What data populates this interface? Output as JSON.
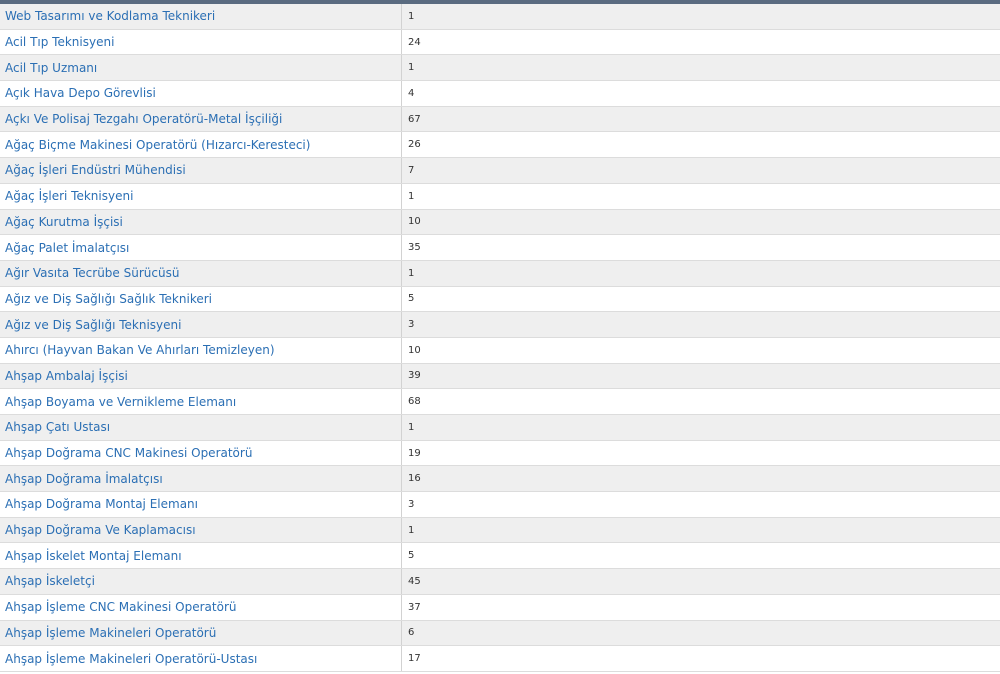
{
  "colors": {
    "link": "#2b6fb4",
    "header_bar": "#5a6b80",
    "row_alt": "#efefef"
  },
  "rows": [
    {
      "name": "Web Tasarımı ve Kodlama Teknikeri",
      "count": "1"
    },
    {
      "name": "Acil Tıp Teknisyeni",
      "count": "24"
    },
    {
      "name": "Acil Tıp Uzmanı",
      "count": "1"
    },
    {
      "name": "Açık Hava Depo Görevlisi",
      "count": "4"
    },
    {
      "name": "Açkı Ve Polisaj Tezgahı Operatörü-Metal İşçiliği",
      "count": "67"
    },
    {
      "name": "Ağaç Biçme Makinesi Operatörü (Hızarcı-Keresteci)",
      "count": "26"
    },
    {
      "name": "Ağaç İşleri Endüstri Mühendisi",
      "count": "7"
    },
    {
      "name": "Ağaç İşleri Teknisyeni",
      "count": "1"
    },
    {
      "name": "Ağaç Kurutma İşçisi",
      "count": "10"
    },
    {
      "name": "Ağaç Palet İmalatçısı",
      "count": "35"
    },
    {
      "name": "Ağır Vasıta Tecrübe Sürücüsü",
      "count": "1"
    },
    {
      "name": "Ağız ve Diş Sağlığı Sağlık Teknikeri",
      "count": "5"
    },
    {
      "name": "Ağız ve Diş Sağlığı Teknisyeni",
      "count": "3"
    },
    {
      "name": "Ahırcı (Hayvan Bakan Ve Ahırları Temizleyen)",
      "count": "10"
    },
    {
      "name": "Ahşap Ambalaj İşçisi",
      "count": "39"
    },
    {
      "name": "Ahşap Boyama ve Vernikleme Elemanı",
      "count": "68"
    },
    {
      "name": "Ahşap Çatı Ustası",
      "count": "1"
    },
    {
      "name": "Ahşap Doğrama CNC Makinesi Operatörü",
      "count": "19"
    },
    {
      "name": "Ahşap Doğrama İmalatçısı",
      "count": "16"
    },
    {
      "name": "Ahşap Doğrama Montaj Elemanı",
      "count": "3"
    },
    {
      "name": "Ahşap Doğrama Ve Kaplamacısı",
      "count": "1"
    },
    {
      "name": "Ahşap İskelet Montaj Elemanı",
      "count": "5"
    },
    {
      "name": "Ahşap İskeletçi",
      "count": "45"
    },
    {
      "name": "Ahşap İşleme CNC Makinesi Operatörü",
      "count": "37"
    },
    {
      "name": "Ahşap İşleme Makineleri Operatörü",
      "count": "6"
    },
    {
      "name": "Ahşap İşleme Makineleri Operatörü-Ustası",
      "count": "17"
    }
  ]
}
